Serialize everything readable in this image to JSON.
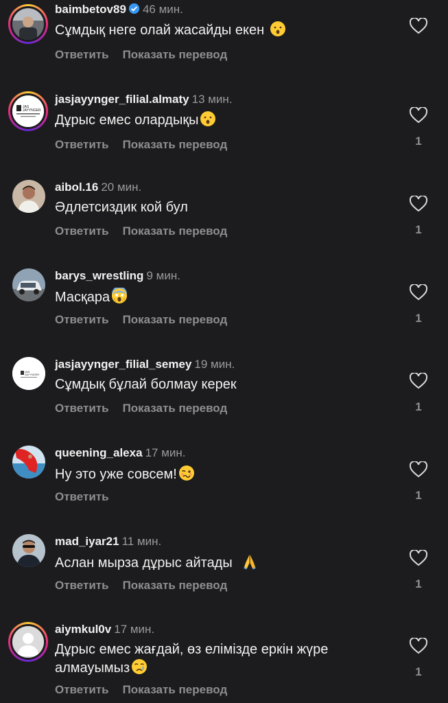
{
  "actions": {
    "reply": "Ответить",
    "translate": "Показать перевод"
  },
  "comments": [
    {
      "username": "baimbetov89",
      "time": "46 мин.",
      "text": "Сұмдық неге олай жасайды екен",
      "emoji_icon": "hushed-face-icon",
      "likes": "",
      "avatar_icon": "man-in-car-avatar",
      "verified": true
    },
    {
      "username": "jasjayynger_filial.almaty",
      "time": "13 мин.",
      "text": "Дұрыс емес олардықы",
      "emoji_icon": "hushed-face-icon",
      "likes": "1",
      "avatar_icon": "jas-jayynger-logo",
      "logo_line1": "JAS",
      "logo_line2": "JAYYNGER",
      "verified": false
    },
    {
      "username": "aibol.16",
      "time": "20 мин.",
      "text": "Әдлетсиздик кой бул",
      "emoji_icon": "",
      "likes": "1",
      "avatar_icon": "man-portrait-avatar",
      "verified": false
    },
    {
      "username": "barys_wrestling",
      "time": "9 мин.",
      "text": "Масқара",
      "emoji_icon": "screaming-face-icon",
      "likes": "1",
      "avatar_icon": "white-car-avatar",
      "verified": false
    },
    {
      "username": "jasjayynger_filial_semey",
      "time": "19 мин.",
      "text": "Сұмдық бұлай болмау керек",
      "emoji_icon": "",
      "likes": "1",
      "avatar_icon": "jas-jayynger-small-logo",
      "logo_line1": "JAS",
      "logo_line2": "JAYYNGER",
      "verified": false
    },
    {
      "username": "queening_alexa",
      "time": "17 мин.",
      "text": "Ну это уже совсем!",
      "emoji_icon": "woozy-face-icon",
      "likes": "1",
      "avatar_icon": "red-dress-sea-avatar",
      "verified": false,
      "no_translate": true
    },
    {
      "username": "mad_iyar21",
      "time": "11 мин.",
      "text": "Аслан мырза дұрыс айтады",
      "emoji_icon": "folded-hands-icon",
      "likes": "1",
      "avatar_icon": "man-sunglasses-avatar",
      "verified": false
    },
    {
      "username": "aiymkul0v",
      "time": "17 мин.",
      "text": "Дұрыс емес жағдай, өз елімізде еркін жүре алмауымыз",
      "emoji_icon": "crying-face-icon",
      "likes": "1",
      "avatar_icon": "default-user-avatar",
      "verified": false
    }
  ],
  "colors": {
    "background": "#1c1c1e",
    "primary_text": "#f2f2f2",
    "secondary_text": "#8e8e93",
    "verified": "#3897f0"
  }
}
